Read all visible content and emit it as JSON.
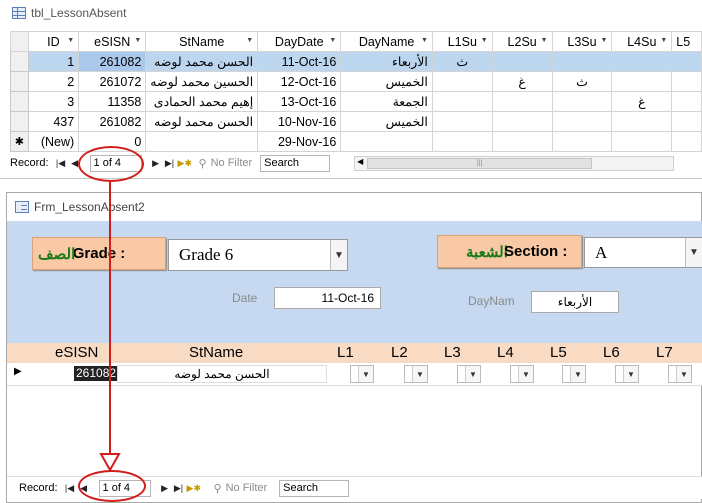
{
  "table_window": {
    "title": "tbl_LessonAbsent",
    "columns": [
      "ID",
      "eSISN",
      "StName",
      "DayDate",
      "DayName",
      "L1Su",
      "L2Su",
      "L3Su",
      "L4Su",
      "L5"
    ],
    "rows": [
      {
        "selector": "",
        "id": "1",
        "esisn": "261082",
        "stname": "الحسن محمد لوضه",
        "daydate": "11-Oct-16",
        "dayname": "الأربعاء",
        "l1": "ث",
        "l2": "",
        "l3": "",
        "l4": ""
      },
      {
        "selector": "",
        "id": "2",
        "esisn": "261072",
        "stname": "الحسين محمد لوضه",
        "daydate": "12-Oct-16",
        "dayname": "الخميس",
        "l1": "",
        "l2": "غ",
        "l3": "ث",
        "l4": ""
      },
      {
        "selector": "",
        "id": "3",
        "esisn": "11358",
        "stname": "إهيم محمد الحمادى",
        "daydate": "13-Oct-16",
        "dayname": "الجمعة",
        "l1": "",
        "l2": "",
        "l3": "",
        "l4": "غ"
      },
      {
        "selector": "",
        "id": "437",
        "esisn": "261082",
        "stname": "الحسن محمد لوضه",
        "daydate": "10-Nov-16",
        "dayname": "الخميس",
        "l1": "",
        "l2": "",
        "l3": "",
        "l4": ""
      },
      {
        "selector": "✱",
        "id": "(New)",
        "esisn": "0",
        "stname": "",
        "daydate": "29-Nov-16",
        "dayname": "",
        "l1": "",
        "l2": "",
        "l3": "",
        "l4": ""
      }
    ],
    "nav": {
      "record_label": "Record:",
      "position": "1 of 4",
      "no_filter": "No Filter",
      "search": "Search"
    }
  },
  "form_window": {
    "title": "Frm_LessonAbsent2",
    "grade_label": "Grade :",
    "grade_label_ar": "الصف",
    "grade_value": "Grade 6",
    "section_label": "Section :",
    "section_label_ar": "الشعبة",
    "section_value": "A",
    "date_label": "Date",
    "date_value": "11-Oct-16",
    "dayname_label": "DayNam",
    "dayname_value": "الأربعاء",
    "sub_columns": [
      "eSISN",
      "StName",
      "L1",
      "L2",
      "L3",
      "L4",
      "L5",
      "L6",
      "L7"
    ],
    "sub_row": {
      "esisn": "261082",
      "stname": "الحسن محمد لوضه"
    },
    "nav": {
      "record_label": "Record:",
      "position": "1 of 4",
      "no_filter": "No Filter",
      "search": "Search"
    }
  },
  "colors": {
    "annotation": "#d21d1d",
    "header_blue": "#c6d9f1",
    "label_orange": "#f8c9a4",
    "current_row": "#bcd6f0"
  }
}
